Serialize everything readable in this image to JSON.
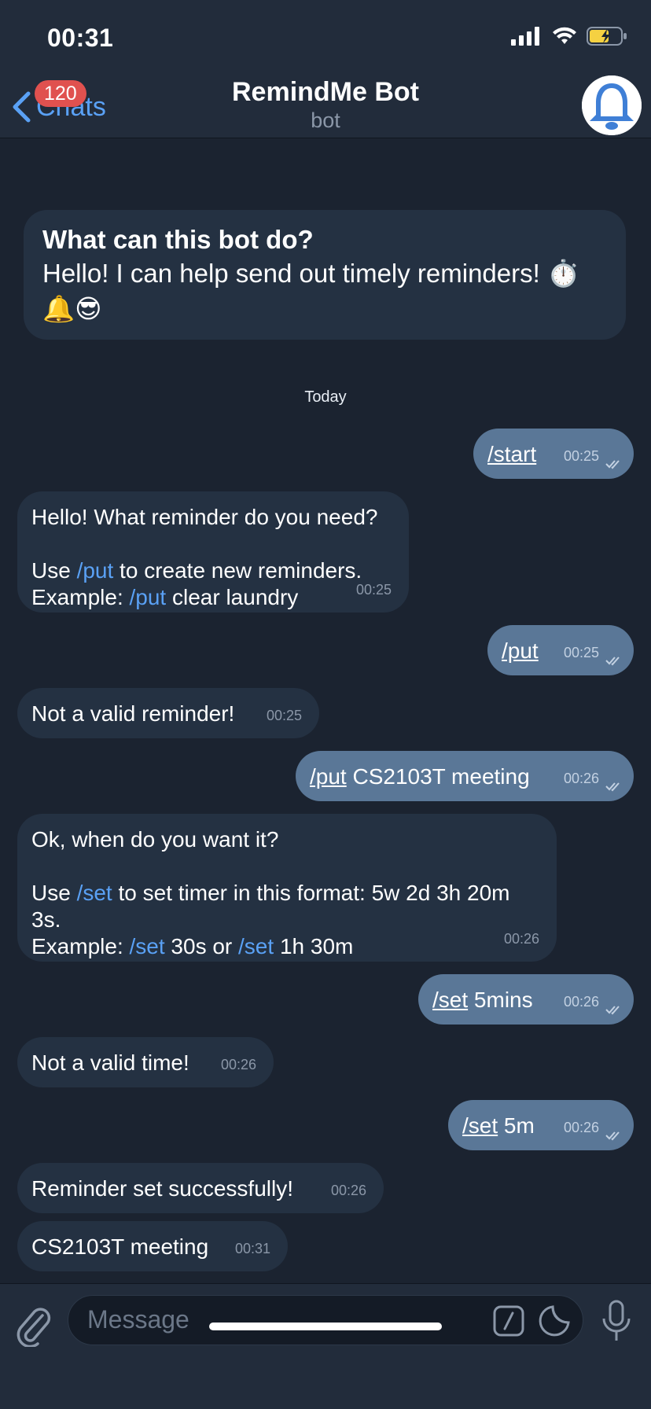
{
  "status_bar": {
    "time": "00:31"
  },
  "header": {
    "back_label": "Chats",
    "unread_count": "120",
    "title": "RemindMe Bot",
    "subtitle": "bot"
  },
  "info_card": {
    "title": "What can this bot do?",
    "text": "Hello! I can help send out timely reminders! ⏱️ 🔔😎"
  },
  "date_separator": "Today",
  "messages": [
    {
      "dir": "out",
      "cmd": "/start",
      "rest": "",
      "time": "00:25"
    },
    {
      "dir": "in",
      "lines": [
        "Hello! What reminder do you need?",
        "",
        "Use /put to create new reminders.",
        "Example: /put clear laundry"
      ],
      "time": "00:25"
    },
    {
      "dir": "out",
      "cmd": "/put",
      "rest": "",
      "time": "00:25"
    },
    {
      "dir": "in",
      "lines": [
        "Not a valid reminder!"
      ],
      "time": "00:25"
    },
    {
      "dir": "out",
      "cmd": "/put",
      "rest": " CS2103T meeting",
      "time": "00:26"
    },
    {
      "dir": "in",
      "lines": [
        "Ok, when do you want it?",
        "",
        "Use /set to set timer in this format: 5w 2d 3h 20m",
        "3s.",
        "Example: /set 30s or /set 1h 30m"
      ],
      "time": "00:26"
    },
    {
      "dir": "out",
      "cmd": "/set",
      "rest": " 5mins",
      "time": "00:26"
    },
    {
      "dir": "in",
      "lines": [
        "Not a valid time!"
      ],
      "time": "00:26"
    },
    {
      "dir": "out",
      "cmd": "/set",
      "rest": " 5m",
      "time": "00:26"
    },
    {
      "dir": "in",
      "lines": [
        "Reminder set successfully!"
      ],
      "time": "00:26"
    },
    {
      "dir": "in",
      "lines": [
        "CS2103T meeting"
      ],
      "time": "00:31"
    }
  ],
  "input": {
    "placeholder": "Message"
  },
  "icons": {
    "back": "chevron-left-icon",
    "attach": "paperclip-icon",
    "commands": "slash-command-icon",
    "sticker": "sticker-icon",
    "mic": "microphone-icon",
    "avatar": "bell-icon",
    "read": "double-check-icon"
  },
  "colors": {
    "background": "#1b2330",
    "bar": "#222c3b",
    "incoming_bubble": "#243142",
    "outgoing_bubble": "#5a7797",
    "link": "#5aa1f5",
    "badge": "#e0514f"
  }
}
